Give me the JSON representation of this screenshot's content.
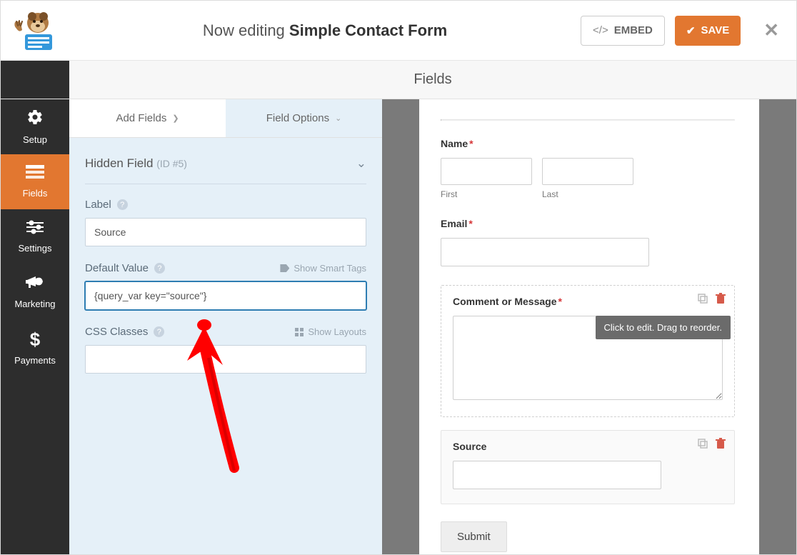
{
  "header": {
    "prefix": "Now editing ",
    "form_name": "Simple Contact Form",
    "embed_label": "EMBED",
    "save_label": "SAVE"
  },
  "sidebar": {
    "items": [
      {
        "label": "Setup"
      },
      {
        "label": "Fields"
      },
      {
        "label": "Settings"
      },
      {
        "label": "Marketing"
      },
      {
        "label": "Payments"
      }
    ]
  },
  "page_title": "Fields",
  "tabs": {
    "add_fields": "Add Fields",
    "field_options": "Field Options"
  },
  "options": {
    "title": "Hidden Field",
    "id_label": "(ID #5)",
    "label_label": "Label",
    "label_value": "Source",
    "default_label": "Default Value",
    "default_value": "{query_var key=\"source\"}",
    "smart_tags": "Show Smart Tags",
    "css_label": "CSS Classes",
    "css_value": "",
    "layouts": "Show Layouts"
  },
  "preview": {
    "name_label": "Name",
    "first_sub": "First",
    "last_sub": "Last",
    "email_label": "Email",
    "comment_label": "Comment or Message",
    "tooltip": "Click to edit. Drag to reorder.",
    "source_label": "Source",
    "submit_label": "Submit"
  }
}
